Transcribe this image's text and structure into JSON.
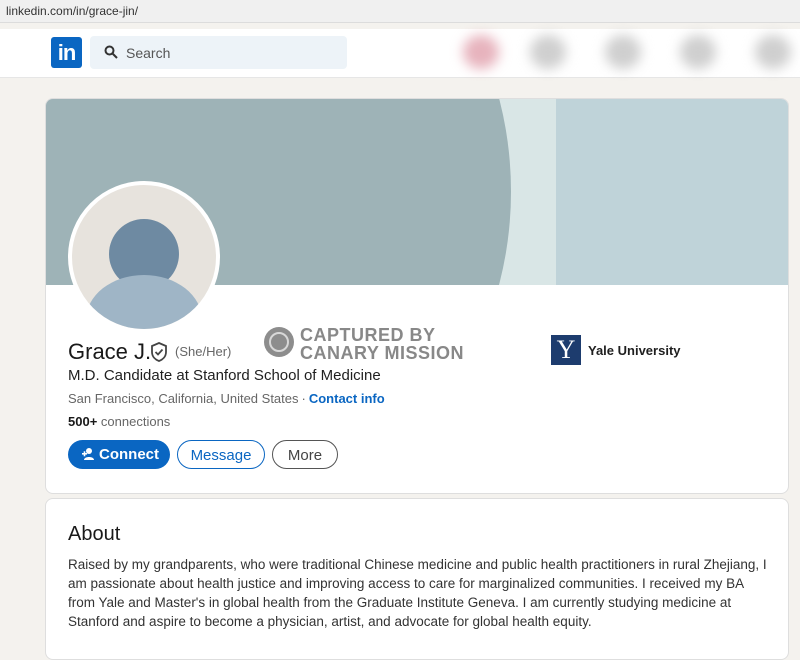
{
  "browser": {
    "url": "linkedin.com/in/grace-jin/"
  },
  "nav": {
    "logo_text": "in",
    "search_placeholder": "Search"
  },
  "profile": {
    "name": "Grace J.",
    "pronouns": "(She/Her)",
    "headline": "M.D. Candidate at Stanford School of Medicine",
    "location": "San Francisco, California, United States",
    "location_separator": "·",
    "contact_link": "Contact info",
    "connections_count": "500+",
    "connections_label": "connections",
    "education": {
      "logo_letter": "Y",
      "name": "Yale University"
    }
  },
  "actions": {
    "connect": "Connect",
    "message": "Message",
    "more": "More"
  },
  "watermark": {
    "line1": "CAPTURED BY",
    "line2": "CANARY MISSION"
  },
  "about": {
    "title": "About",
    "text": "Raised by my grandparents, who were traditional Chinese medicine and public health practitioners in rural Zhejiang, I am passionate about health justice and improving access to care for marginalized communities. I received my BA from Yale and Master's in global health from the Graduate Institute Geneva. I am currently studying medicine at Stanford and aspire to become a physician, artist, and advocate for global health equity."
  },
  "colors": {
    "brand_blue": "#0a66c2",
    "page_bg": "#f4f2ee",
    "cover_dark": "#9eb3b7",
    "cover_light": "#bfd3d9",
    "school_navy": "#1d3c6e"
  }
}
